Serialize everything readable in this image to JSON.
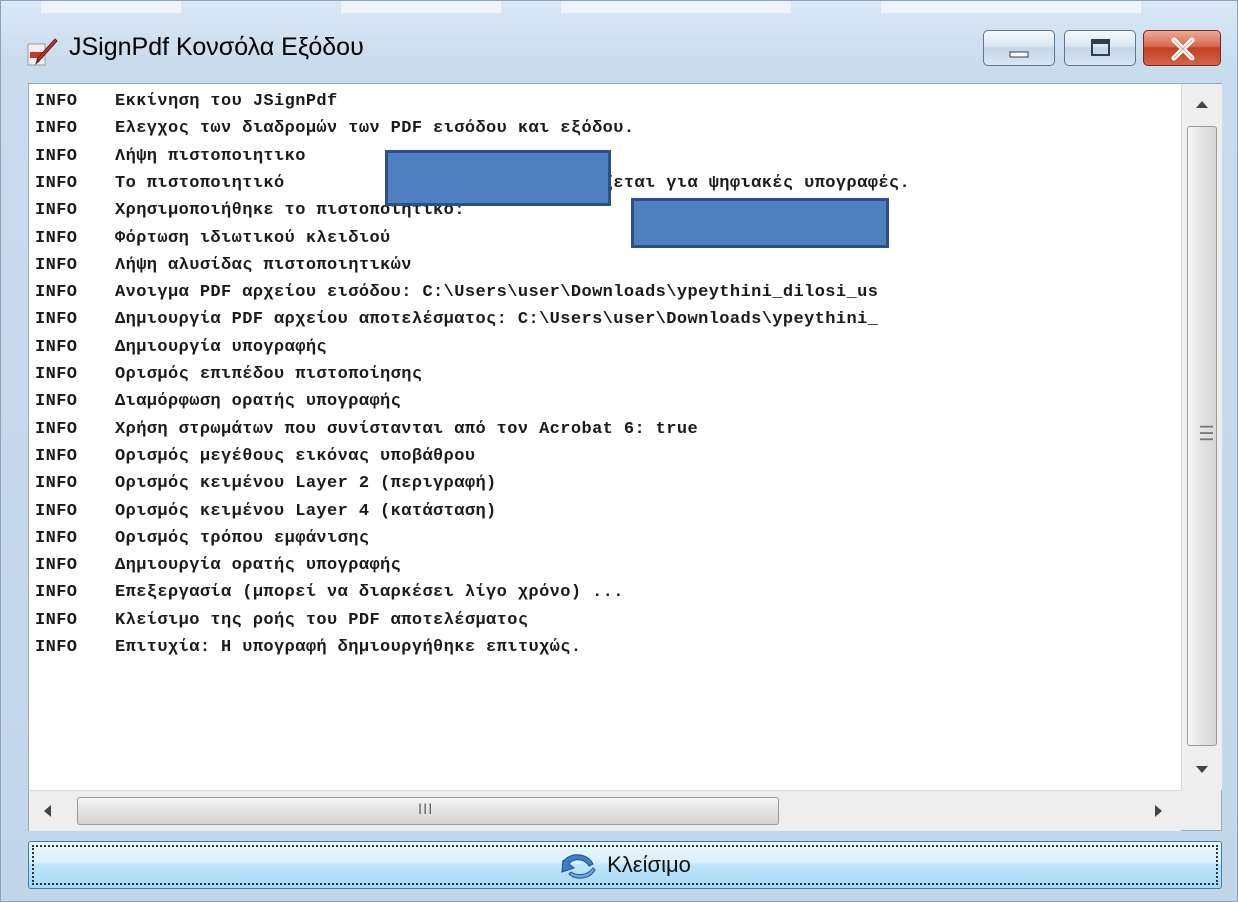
{
  "window": {
    "title": "JSignPdf Κονσόλα Εξόδου",
    "icons": {
      "app": "jsignpdf-pen-icon",
      "minimize": "minimize-icon",
      "maximize": "maximize-icon",
      "close": "close-x-icon"
    },
    "colors": {
      "close_button": "#c1401f",
      "redaction": "#4f7fc0"
    }
  },
  "console": {
    "lines": [
      {
        "level": "INFO",
        "text": "Εκκίνηση του JSignPdf"
      },
      {
        "level": "INFO",
        "text": "Ελεγχος των διαδρομών των PDF εισόδου και εξόδου."
      },
      {
        "level": "INFO",
        "text": "Λήψη πιστοποιητικο"
      },
      {
        "level": "INFO",
        "text": "Το πιστοποιητικό                    δεν προορίζεται για ψηφιακές υπογραφές."
      },
      {
        "level": "INFO",
        "text": "Χρησιμοποιήθηκε το πιστοποιητικό: "
      },
      {
        "level": "INFO",
        "text": "Φόρτωση ιδιωτικού κλειδιού"
      },
      {
        "level": "INFO",
        "text": "Λήψη αλυσίδας πιστοποιητικών"
      },
      {
        "level": "INFO",
        "text": "Ανοιγμα PDF αρχείου εισόδου: C:\\Users\\user\\Downloads\\ypeythini_dilosi_us"
      },
      {
        "level": "INFO",
        "text": "Δημιουργία PDF αρχείου αποτελέσματος: C:\\Users\\user\\Downloads\\ypeythini_"
      },
      {
        "level": "INFO",
        "text": "Δημιουργία υπογραφής"
      },
      {
        "level": "INFO",
        "text": "Ορισμός επιπέδου πιστοποίησης"
      },
      {
        "level": "INFO",
        "text": "Διαμόρφωση ορατής υπογραφής"
      },
      {
        "level": "INFO",
        "text": "Χρήση στρωμάτων που συνίστανται από τον Acrobat 6: true"
      },
      {
        "level": "INFO",
        "text": "Ορισμός μεγέθους εικόνας υποβάθρου"
      },
      {
        "level": "INFO",
        "text": "Ορισμός κειμένου Layer 2 (περιγραφή)"
      },
      {
        "level": "INFO",
        "text": "Ορισμός κειμένου Layer 4 (κατάσταση)"
      },
      {
        "level": "INFO",
        "text": "Ορισμός τρόπου εμφάνισης"
      },
      {
        "level": "INFO",
        "text": "Δημιουργία ορατής υπογραφής"
      },
      {
        "level": "INFO",
        "text": "Επεξεργασία (μπορεί να διαρκέσει λίγο χρόνο) ..."
      },
      {
        "level": "INFO",
        "text": "Κλείσιμο της ροής του PDF αποτελέσματος"
      },
      {
        "level": "INFO",
        "text": "Επιτυχία: Η υπογραφή δημιουργήθηκε επιτυχώς."
      }
    ],
    "scrollbar_grip_horizontal": "III",
    "scrollbar_grip_vertical": "III"
  },
  "footer": {
    "close_label": "Κλείσιμο",
    "close_icon": "back-arrow-icon"
  }
}
